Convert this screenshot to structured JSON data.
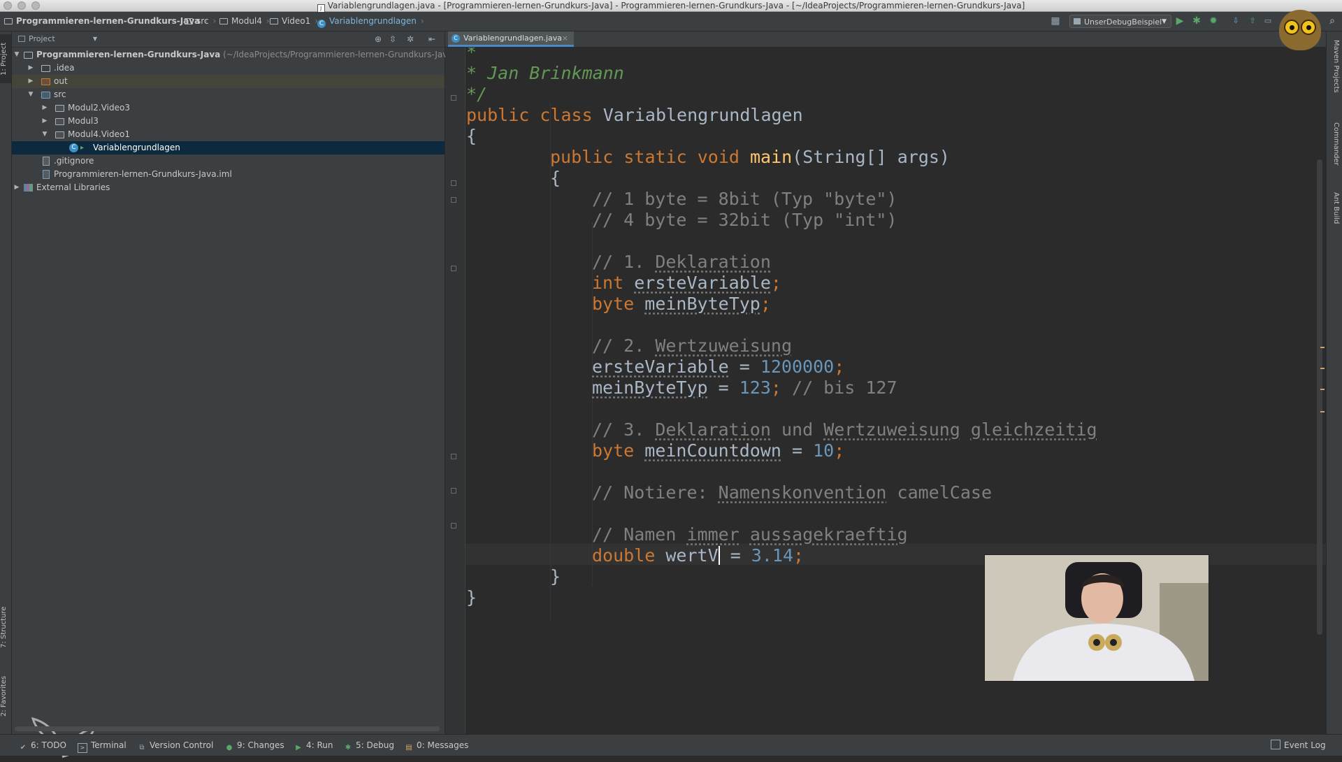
{
  "window": {
    "title": "Variablengrundlagen.java - [Programmieren-lernen-Grundkurs-Java] - Programmieren-lernen-Grundkurs-Java - [~/IdeaProjects/Programmieren-lernen-Grundkurs-Java]"
  },
  "breadcrumbs": [
    {
      "label": "Programmieren-lernen-Grundkurs-Java",
      "icon": "project-icon"
    },
    {
      "label": "src",
      "icon": "folder-icon"
    },
    {
      "label": "Modul4",
      "icon": "package-icon"
    },
    {
      "label": "Video1",
      "icon": "package-icon"
    },
    {
      "label": "Variablengrundlagen",
      "icon": "class-icon"
    }
  ],
  "toolbar": {
    "run_config": "UnserDebugBeispiel",
    "icons": [
      "build-icon",
      "run-icon",
      "debug-icon",
      "coverage-icon",
      "vcs-update-icon",
      "vcs-commit-icon",
      "search-icon"
    ]
  },
  "left_strip": {
    "project_tab": "1: Project",
    "structure_tab": "7: Structure",
    "favorites_tab": "2: Favorites"
  },
  "right_strip": {
    "maven_tab": "Maven Projects",
    "commander_tab": "Commander",
    "ant_tab": "Ant Build"
  },
  "project_panel": {
    "view_selector": "Project",
    "root_name": "Programmieren-lernen-Grundkurs-Java",
    "root_path": "(~/IdeaProjects/Programmieren-lernen-Grundkurs-Java)",
    "items": [
      {
        "label": ".idea"
      },
      {
        "label": "out"
      },
      {
        "label": "src"
      },
      {
        "label": "Modul2.Video3"
      },
      {
        "label": "Modul3"
      },
      {
        "label": "Modul4.Video1"
      },
      {
        "label": "Variablengrundlagen"
      },
      {
        "label": ".gitignore"
      },
      {
        "label": "Programmieren-lernen-Grundkurs-Java.iml"
      },
      {
        "label": "External Libraries"
      }
    ]
  },
  "editor": {
    "tab_label": "Variablengrundlagen.java",
    "code": {
      "l0": "*",
      "l1": "* Jan Brinkmann",
      "l2": "*/",
      "l3_kw": "public class",
      "l3_name": "Variablengrundlagen",
      "l4": "{",
      "l5_kw": "public static void",
      "l5_fn": "main",
      "l5_rest": "(String[] args)",
      "l6": "{",
      "l7": "// 1 byte = 8bit (Typ \"byte\")",
      "l8": "// 4 byte = 32bit (Typ \"int\")",
      "l10_a": "// 1.",
      "l10_b": "Deklaration",
      "l11_kw": "int",
      "l11_var": "ersteVariable",
      "l12_kw": "byte",
      "l12_var": "meinByteTyp",
      "l14_a": "// 2.",
      "l14_b": "Wertzuweisung",
      "l15_var": "ersteVariable",
      "l15_eq": " = ",
      "l15_num": "1200000",
      "l16_var": "meinByteTyp",
      "l16_eq": " = ",
      "l16_num": "123",
      "l16_cm": "// bis 127",
      "l18_a": "// 3.",
      "l18_b": "Deklaration",
      "l18_c": "und",
      "l18_d": "Wertzuweisung",
      "l18_e": "gleichzeitig",
      "l19_kw": "byte",
      "l19_var": "meinCountdown",
      "l19_eq": " = ",
      "l19_num": "10",
      "l21_a": "// Notiere:",
      "l21_b": "Namenskonvention",
      "l21_c": "camelCase",
      "l23_a": "// Namen",
      "l23_b": "immer",
      "l23_c": "aussagekraeftig",
      "l24_kw": "double",
      "l24_var": "wertV",
      "l24_eq": " = ",
      "l24_num": "3.14",
      "semi": ";",
      "l25": "}",
      "l26": "}"
    }
  },
  "bottom_tools": [
    {
      "label": "6: TODO",
      "icon": "todo-icon"
    },
    {
      "label": "Terminal",
      "icon": "terminal-icon"
    },
    {
      "label": "Version Control",
      "icon": "version-control-icon"
    },
    {
      "label": "9: Changes",
      "icon": "changes-icon"
    },
    {
      "label": "4: Run",
      "icon": "run-icon"
    },
    {
      "label": "5: Debug",
      "icon": "debug-icon"
    },
    {
      "label": "0: Messages",
      "icon": "messages-icon"
    }
  ],
  "event_log": "Event Log",
  "colors": {
    "keyword": "#cc7832",
    "comment": "#808080",
    "doc_comment": "#629755",
    "number": "#6897bb",
    "method": "#ffc66d",
    "selection": "#0d293e"
  }
}
